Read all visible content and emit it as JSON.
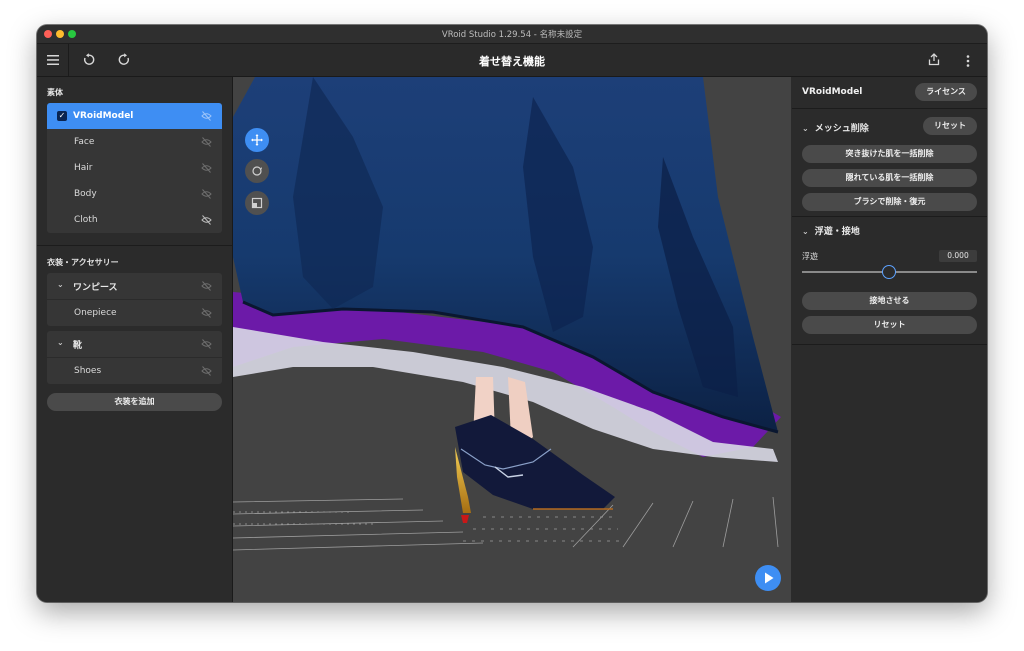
{
  "window": {
    "title": "VRoid Studio 1.29.54 - 名称未設定"
  },
  "toolbar": {
    "title": "着せ替え機能"
  },
  "left": {
    "section_base": "素体",
    "base_items": [
      {
        "label": "VRoidModel",
        "selected": true
      },
      {
        "label": "Face"
      },
      {
        "label": "Hair"
      },
      {
        "label": "Body"
      },
      {
        "label": "Cloth"
      }
    ],
    "section_costume": "衣装・アクセサリー",
    "groups": [
      {
        "label": "ワンピース",
        "items": [
          {
            "label": "Onepiece"
          }
        ]
      },
      {
        "label": "靴",
        "items": [
          {
            "label": "Shoes"
          }
        ]
      }
    ],
    "add_costume": "衣装を追加"
  },
  "right": {
    "model_name": "VRoidModel",
    "license_button": "ライセンス",
    "mesh_section": "メッシュ削除",
    "reset_button": "リセット",
    "mesh_buttons": [
      "突き抜けた肌を一括削除",
      "隠れている肌を一括削除",
      "ブラシで削除・復元"
    ],
    "float_section": "浮遊・接地",
    "float_label": "浮遊",
    "float_value": "0.000",
    "ground_button": "接地させる",
    "reset_button2": "リセット"
  },
  "icons": {
    "menu": "hamburger-icon",
    "undo": "undo-icon",
    "redo": "redo-icon",
    "share": "share-icon",
    "more": "more-vertical-icon",
    "visibility": "eye-off-icon",
    "move": "move-icon",
    "rotate": "rotate-icon",
    "zoom": "zoom-icon",
    "play": "play-icon"
  },
  "colors": {
    "accent": "#3e8ef3",
    "panel": "#2b2b2b",
    "viewport": "#434343"
  }
}
